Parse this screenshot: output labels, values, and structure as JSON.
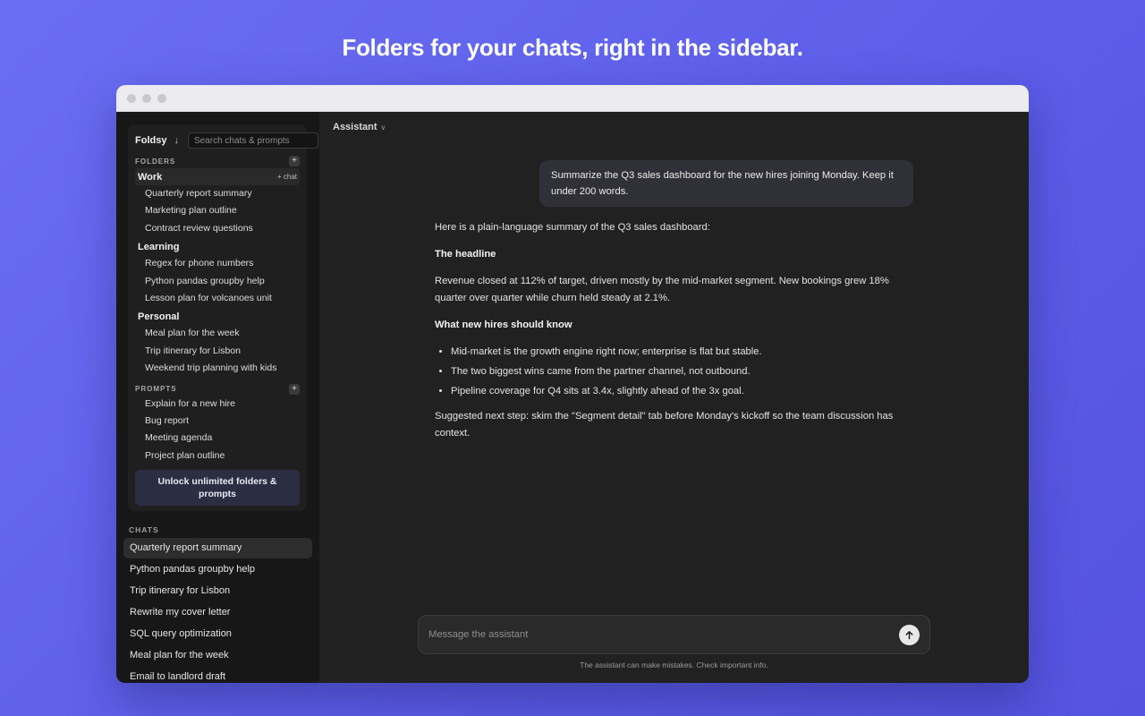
{
  "headline": "Folders for your chats, right in the sidebar.",
  "sidebar": {
    "brand": "Foldsy",
    "brand_arrow": "↓",
    "search_placeholder": "Search chats & prompts",
    "folders_label": "FOLDERS",
    "add_folder": "+",
    "add_chat": "+ chat",
    "folders": [
      {
        "name": "Work",
        "items": [
          "Quarterly report summary",
          "Marketing plan outline",
          "Contract review questions"
        ]
      },
      {
        "name": "Learning",
        "items": [
          "Regex for phone numbers",
          "Python pandas groupby help",
          "Lesson plan for volcanoes unit"
        ]
      },
      {
        "name": "Personal",
        "items": [
          "Meal plan for the week",
          "Trip itinerary for Lisbon",
          "Weekend trip planning with kids"
        ]
      }
    ],
    "prompts_label": "PROMPTS",
    "add_prompt": "+",
    "prompts": [
      "Explain for a new hire",
      "Bug report",
      "Meeting agenda",
      "Project plan outline"
    ],
    "unlock_label": "Unlock unlimited folders & prompts",
    "chats_label": "CHATS",
    "chats": [
      "Quarterly report summary",
      "Python pandas groupby help",
      "Trip itinerary for Lisbon",
      "Rewrite my cover letter",
      "SQL query optimization",
      "Meal plan for the week",
      "Email to landlord draft"
    ]
  },
  "main": {
    "model": "Assistant",
    "model_chevron": "∨",
    "user_message": "Summarize the Q3 sales dashboard for the new hires joining Monday. Keep it under 200 words.",
    "reply": {
      "intro": "Here is a plain-language summary of the Q3 sales dashboard:",
      "h1": "The headline",
      "p1": "Revenue closed at 112% of target, driven mostly by the mid-market segment. New bookings grew 18% quarter over quarter while churn held steady at 2.1%.",
      "h2": "What new hires should know",
      "bullets": [
        "Mid-market is the growth engine right now; enterprise is flat but stable.",
        "The two biggest wins came from the partner channel, not outbound.",
        "Pipeline coverage for Q4 sits at 3.4x, slightly ahead of the 3x goal."
      ],
      "closing": "Suggested next step: skim the \"Segment detail\" tab before Monday's kickoff so the team discussion has context."
    },
    "composer_placeholder": "Message the assistant",
    "disclaimer": "The assistant can make mistakes. Check important info."
  }
}
